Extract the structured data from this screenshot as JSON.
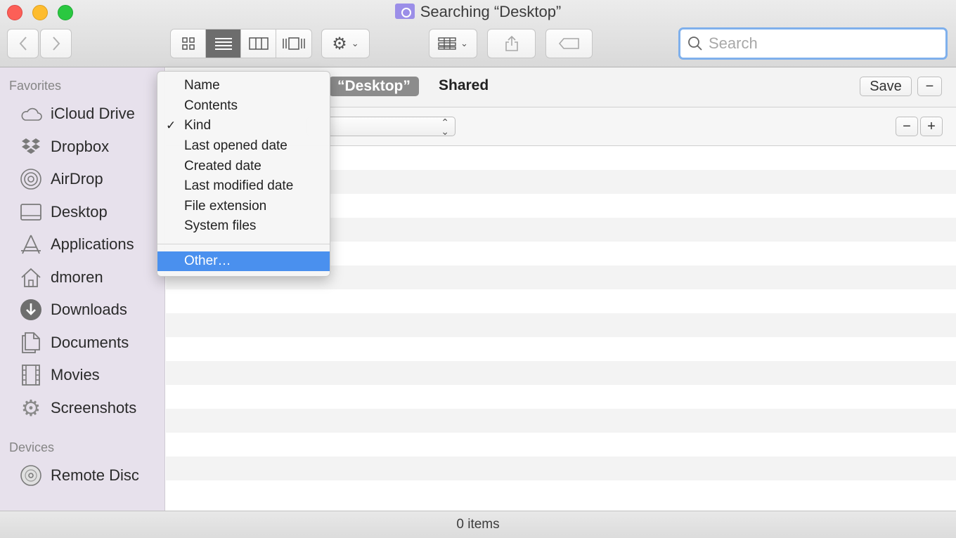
{
  "window": {
    "title": "Searching “Desktop”"
  },
  "toolbar": {
    "back_icon": "chevron-left-icon",
    "forward_icon": "chevron-right-icon",
    "view_modes": [
      "icon-view-icon",
      "list-view-icon",
      "column-view-icon",
      "cover-flow-icon"
    ],
    "active_view": "list-view-icon",
    "search_placeholder": "Search"
  },
  "sidebar": {
    "favorites_label": "Favorites",
    "favorites": [
      {
        "label": "iCloud Drive",
        "icon": "cloud-icon"
      },
      {
        "label": "Dropbox",
        "icon": "dropbox-icon"
      },
      {
        "label": "AirDrop",
        "icon": "airdrop-icon"
      },
      {
        "label": "Desktop",
        "icon": "desktop-icon"
      },
      {
        "label": "Applications",
        "icon": "applications-icon"
      },
      {
        "label": "dmoren",
        "icon": "home-icon"
      },
      {
        "label": "Downloads",
        "icon": "download-icon"
      },
      {
        "label": "Documents",
        "icon": "document-icon"
      },
      {
        "label": "Movies",
        "icon": "film-icon"
      },
      {
        "label": "Screenshots",
        "icon": "gear-icon"
      }
    ],
    "devices_label": "Devices",
    "devices": [
      {
        "label": "Remote Disc",
        "icon": "disc-icon"
      }
    ]
  },
  "scope_bar": {
    "scope_desktop": "“Desktop”",
    "scope_shared": "Shared",
    "save_label": "Save"
  },
  "menu": {
    "items": [
      {
        "label": "Name",
        "checked": false
      },
      {
        "label": "Contents",
        "checked": false
      },
      {
        "label": "Kind",
        "checked": true
      },
      {
        "label": "Last opened date",
        "checked": false
      },
      {
        "label": "Created date",
        "checked": false
      },
      {
        "label": "Last modified date",
        "checked": false
      },
      {
        "label": "File extension",
        "checked": false
      },
      {
        "label": "System files",
        "checked": false
      }
    ],
    "other_label": "Other…",
    "check_glyph": "✓"
  },
  "status": {
    "item_count": "0 items"
  },
  "colors": {
    "sidebar_bg": "#e7e1ec",
    "menu_highlight": "#4a90ee",
    "search_focus": "#7fb0ec"
  }
}
